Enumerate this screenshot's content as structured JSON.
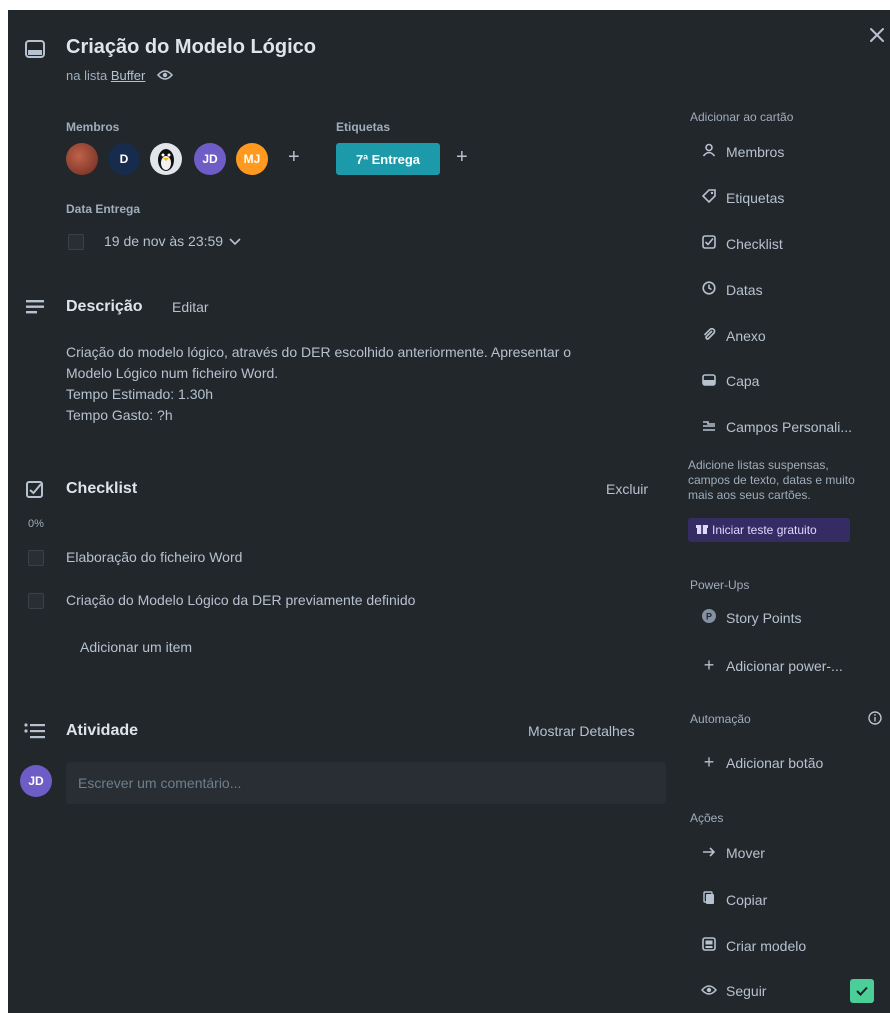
{
  "card": {
    "title": "Criação do Modelo Lógico",
    "list_prefix": "na lista",
    "list_name": "Buffer"
  },
  "members": {
    "label": "Membros",
    "avatars": [
      {
        "initials": "",
        "color": "#8a3b2a"
      },
      {
        "initials": "D",
        "color": "#172b4d"
      },
      {
        "initials": "",
        "color": "#e2e6ea"
      },
      {
        "initials": "JD",
        "color": "#6e5dc6"
      },
      {
        "initials": "MJ",
        "color": "#ff991f"
      }
    ]
  },
  "labels": {
    "label": "Etiquetas",
    "items": [
      {
        "text": "7ª Entrega",
        "color": "#1d9aaa"
      }
    ]
  },
  "due": {
    "label": "Data Entrega",
    "value": "19 de nov às 23:59"
  },
  "description": {
    "heading": "Descrição",
    "edit_label": "Editar",
    "lines": [
      "Criação do modelo lógico, através do DER escolhido anteriormente. Apresentar o",
      "Modelo Lógico num ficheiro Word.",
      "Tempo Estimado: 1.30h",
      "Tempo Gasto: ?h"
    ]
  },
  "checklist": {
    "heading": "Checklist",
    "delete_label": "Excluir",
    "progress": "0%",
    "progress_value": 0,
    "items": [
      {
        "text": "Elaboração do ficheiro Word",
        "checked": false
      },
      {
        "text": "Criação do Modelo Lógico da DER previamente definido",
        "checked": false
      }
    ],
    "add_item_label": "Adicionar um item"
  },
  "activity": {
    "heading": "Atividade",
    "details_label": "Mostrar Detalhes",
    "avatar_initials": "JD",
    "comment_placeholder": "Escrever um comentário..."
  },
  "sidebar": {
    "add_to_card_heading": "Adicionar ao cartão",
    "add_items": [
      {
        "icon": "person-icon",
        "label": "Membros"
      },
      {
        "icon": "tag-icon",
        "label": "Etiquetas"
      },
      {
        "icon": "checklist-icon",
        "label": "Checklist"
      },
      {
        "icon": "clock-icon",
        "label": "Datas"
      },
      {
        "icon": "paperclip-icon",
        "label": "Anexo"
      },
      {
        "icon": "card-cover-icon",
        "label": "Capa"
      },
      {
        "icon": "custom-fields-icon",
        "label": "Campos Personali..."
      }
    ],
    "promo_lines": [
      "Adicione listas suspensas,",
      "campos de texto, datas e muito",
      "mais aos seus cartões."
    ],
    "trial_label": "Iniciar teste gratuito",
    "powerups_heading": "Power-Ups",
    "powerups": [
      {
        "icon": "story-points-icon",
        "label": "Story Points"
      },
      {
        "icon": "plus-icon",
        "label": "Adicionar power-..."
      }
    ],
    "automation_heading": "Automação",
    "automation_items": [
      {
        "icon": "plus-icon",
        "label": "Adicionar botão"
      }
    ],
    "actions_heading": "Ações",
    "actions": [
      {
        "icon": "arrow-right-icon",
        "label": "Mover"
      },
      {
        "icon": "copy-icon",
        "label": "Copiar"
      },
      {
        "icon": "template-icon",
        "label": "Criar modelo"
      },
      {
        "icon": "eye-icon",
        "label": "Seguir"
      }
    ]
  },
  "colors": {
    "background": "#22272b",
    "label_teal": "#1d9aaa",
    "follow_green": "#4bce97",
    "trial_purple": "#352c63"
  }
}
